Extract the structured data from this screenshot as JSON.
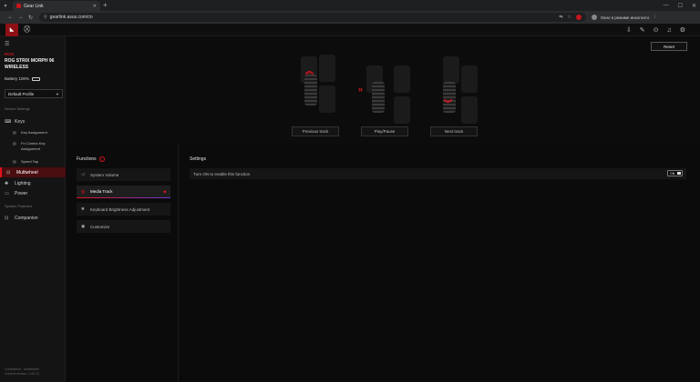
{
  "browser": {
    "tab_title": "Gear Link",
    "tab_close": "✕",
    "new_tab": "+",
    "url": "gearlink.asus.com/cn",
    "window_min": "—",
    "window_max": "☐",
    "window_close": "✕",
    "profile_text": "Окно в режиме инкогнито"
  },
  "sidebar": {
    "brand": "ROG",
    "device_name": "ROG STRIX MORPH 96 WIRELESS",
    "battery": "Battery 100%",
    "profile": "Default Profile",
    "device_settings_label": "Device Settings",
    "keys": "Keys",
    "key_assignment": "Key Assignment",
    "fn_combo": "Fn Combo Key Assignment",
    "speed_tap": "Speed Tap",
    "multiwheel": "Multiwheel",
    "lighting": "Lighting",
    "power": "Power",
    "system_features_label": "System Features",
    "companion": "Companion",
    "footer_line1": "Companion - Multiwheel",
    "footer_line2": "Current Version: 1.00.12"
  },
  "preview": {
    "reset": "Reset",
    "previous_track": "Previous track",
    "play_pause": "Play/Pause",
    "next_track": "Next track"
  },
  "functions": {
    "title": "Functions",
    "items": [
      {
        "label": "System Volume"
      },
      {
        "label": "Media Track"
      },
      {
        "label": "Keyboard Brightness Adjustment"
      },
      {
        "label": "Customize"
      }
    ]
  },
  "settings": {
    "title": "Settings",
    "row_text": "Turn ON to enable this function",
    "toggle_label": "ON"
  },
  "colors": {
    "accent": "#e0141d",
    "active_bg": "#4a0d10"
  }
}
